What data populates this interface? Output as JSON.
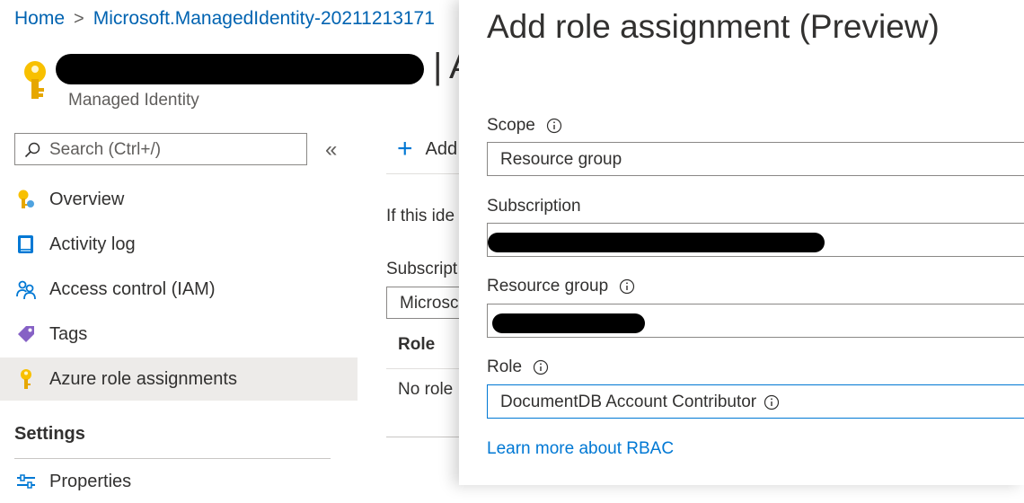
{
  "breadcrumb": {
    "home": "Home",
    "separator": ">",
    "resource": "Microsoft.ManagedIdentity-20211213171"
  },
  "resource": {
    "title_tail": "A",
    "title_pipe": "|",
    "subtitle": "Managed Identity"
  },
  "search": {
    "placeholder": "Search (Ctrl+/)",
    "collapse_glyph": "«"
  },
  "nav": {
    "items": [
      {
        "label": "Overview",
        "icon": "key-overview-icon"
      },
      {
        "label": "Activity log",
        "icon": "activity-log-icon"
      },
      {
        "label": "Access control (IAM)",
        "icon": "people-icon"
      },
      {
        "label": "Tags",
        "icon": "tag-icon"
      },
      {
        "label": "Azure role assignments",
        "icon": "key-icon",
        "selected": true
      }
    ],
    "settings_header": "Settings",
    "settings_items": [
      {
        "label": "Properties",
        "icon": "properties-icon"
      }
    ]
  },
  "background": {
    "add_label": "Add",
    "add_glyph": "+",
    "description": "If this ide",
    "subscription_label": "Subscript",
    "subscription_value": "Microsc",
    "column_role": "Role",
    "no_role": "No role"
  },
  "panel": {
    "title": "Add role assignment (Preview)",
    "scope_label": "Scope",
    "scope_value": "Resource group",
    "subscription_label": "Subscription",
    "resource_group_label": "Resource group",
    "role_label": "Role",
    "role_value": "DocumentDB Account Contributor",
    "learn_more": "Learn more about RBAC"
  },
  "colors": {
    "accent": "#0078d4",
    "link": "#0063b1",
    "selected_bg": "#edebe9",
    "text": "#323130"
  }
}
